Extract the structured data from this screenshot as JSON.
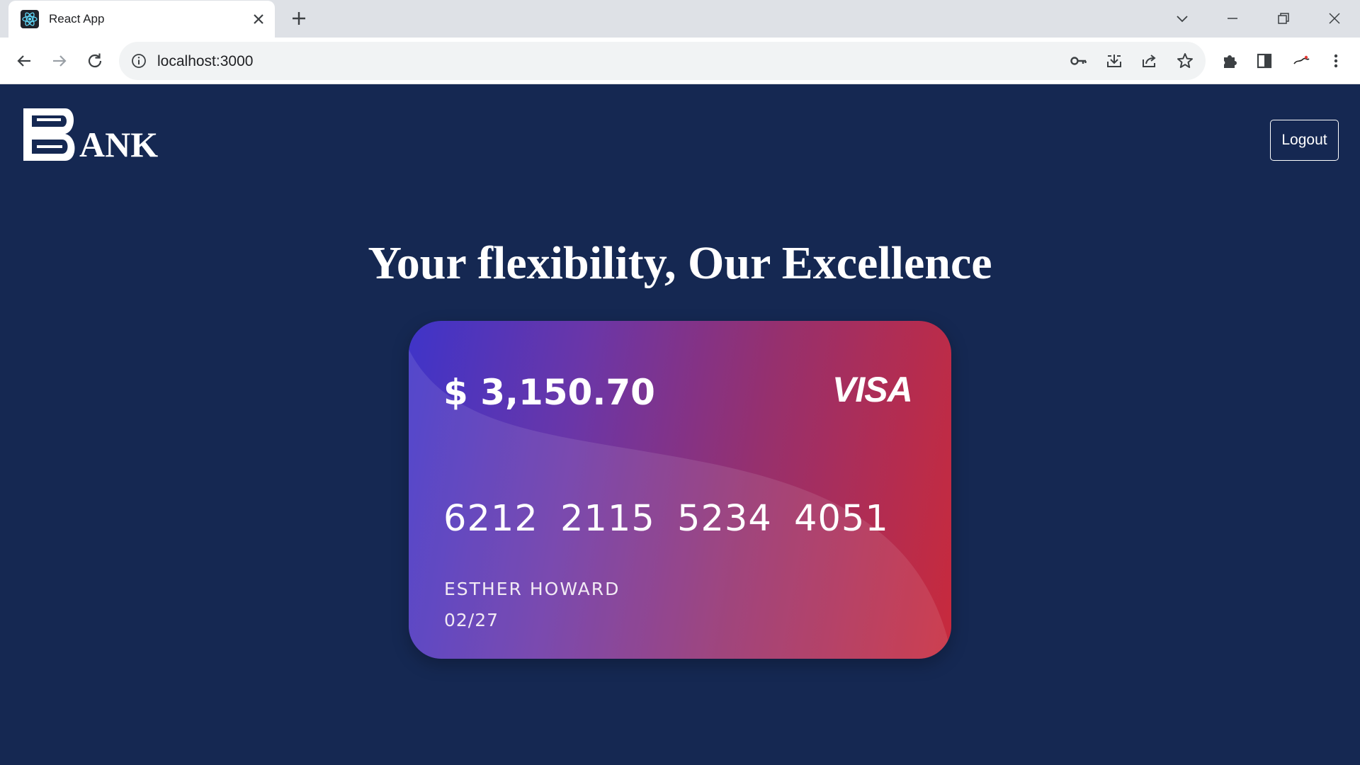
{
  "browser": {
    "tab": {
      "title": "React App",
      "favicon": "react-logo-icon"
    },
    "address_bar": {
      "url": "localhost:3000"
    },
    "icons": {
      "back": "arrow-left-icon",
      "forward": "arrow-right-icon",
      "reload": "reload-icon",
      "info": "info-icon",
      "password": "key-icon",
      "install": "download-icon",
      "share": "share-icon",
      "bookmark": "star-icon",
      "extensions": "puzzle-icon",
      "side_panel": "side-panel-icon",
      "profile": "avatar",
      "menu": "kebab-menu-icon"
    }
  },
  "header": {
    "logo_letter": "B",
    "logo_text": "ANK",
    "logout_label": "Logout"
  },
  "hero": {
    "headline": "Your flexibility, Our Excellence"
  },
  "card": {
    "balance": "$ 3,150.70",
    "brand": "VISA",
    "number": "6212  2115  5234  4051",
    "holder": "ESTHER HOWARD",
    "expiry": "02/27"
  },
  "colors": {
    "page_background": "#152852",
    "card_gradient_start": "#3f34c8",
    "card_gradient_end": "#c82a3c",
    "text": "#ffffff"
  }
}
